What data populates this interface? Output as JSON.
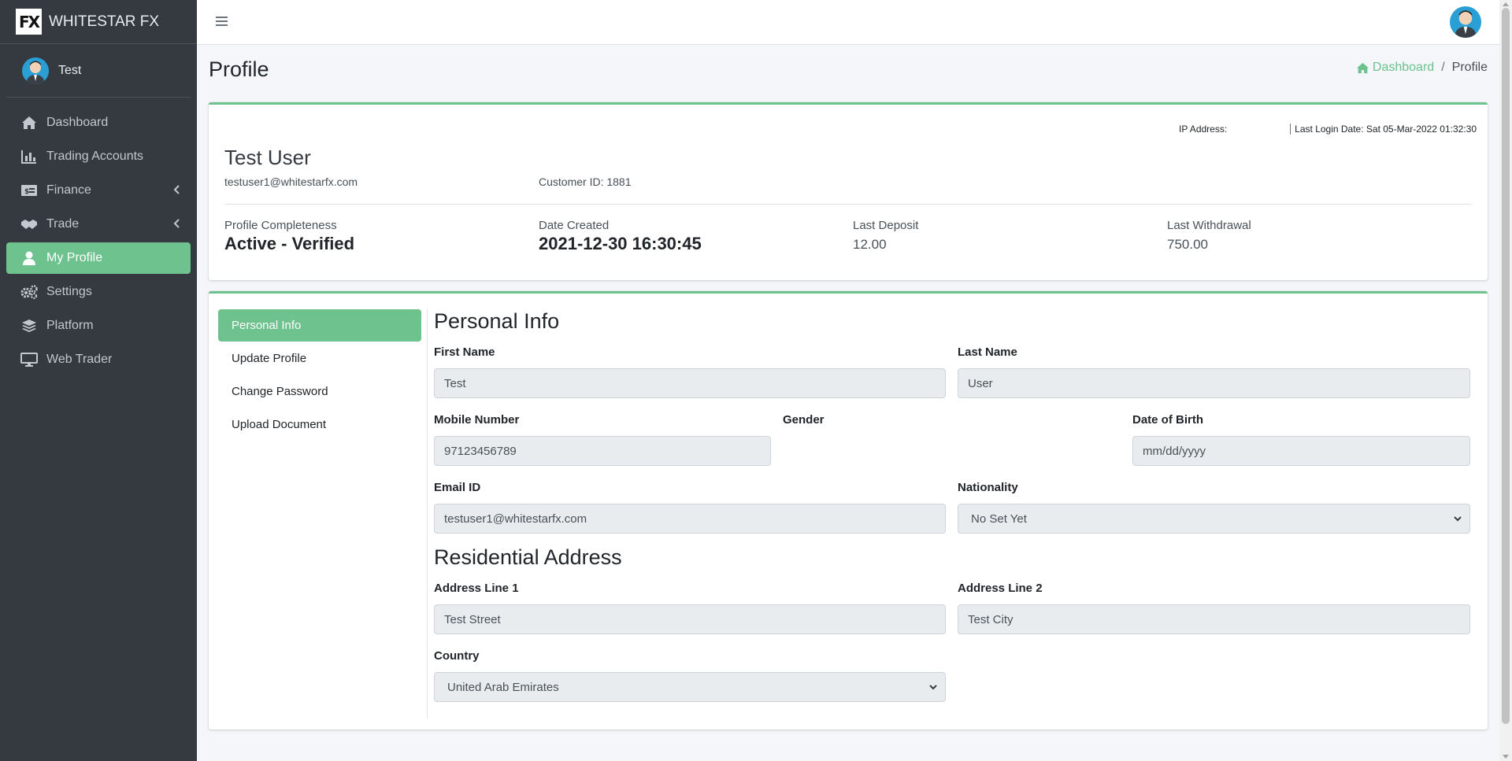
{
  "brand": {
    "logo": "FX",
    "name": "WHITESTAR FX"
  },
  "user": {
    "name": "Test"
  },
  "sidebar": {
    "items": [
      {
        "label": "Dashboard",
        "icon": "home-icon"
      },
      {
        "label": "Trading Accounts",
        "icon": "chart-bar-icon"
      },
      {
        "label": "Finance",
        "icon": "money-bill-icon",
        "has_submenu": true
      },
      {
        "label": "Trade",
        "icon": "handshake-icon",
        "has_submenu": true
      },
      {
        "label": "My Profile",
        "icon": "user-icon",
        "active": true
      },
      {
        "label": "Settings",
        "icon": "cogs-icon"
      },
      {
        "label": "Platform",
        "icon": "layers-icon"
      },
      {
        "label": "Web Trader",
        "icon": "desktop-icon"
      }
    ]
  },
  "header": {
    "title": "Profile",
    "breadcrumb": {
      "home": "Dashboard",
      "sep": "/",
      "current": "Profile"
    }
  },
  "profile": {
    "ip_label": "IP Address:",
    "last_login": "Last Login Date: Sat 05-Mar-2022 01:32:30",
    "name": "Test User",
    "email": "testuser1@whitestarfx.com",
    "customer_id": "Customer ID: 1881",
    "stats": {
      "completeness_label": "Profile Completeness",
      "completeness_value": "Active - Verified",
      "created_label": "Date Created",
      "created_value": "2021-12-30 16:30:45",
      "deposit_label": "Last Deposit",
      "deposit_value": "12.00",
      "withdrawal_label": "Last Withdrawal",
      "withdrawal_value": "750.00"
    }
  },
  "tabs": [
    "Personal Info",
    "Update Profile",
    "Change Password",
    "Upload Document"
  ],
  "personal": {
    "title": "Personal Info",
    "first_name_label": "First Name",
    "first_name": "Test",
    "last_name_label": "Last Name",
    "last_name": "User",
    "mobile_label": "Mobile Number",
    "mobile": "97123456789",
    "gender_label": "Gender",
    "dob_label": "Date of Birth",
    "dob_placeholder": "mm/dd/yyyy",
    "email_label": "Email ID",
    "email": "testuser1@whitestarfx.com",
    "nationality_label": "Nationality",
    "nationality": "No Set Yet"
  },
  "address": {
    "title": "Residential Address",
    "line1_label": "Address Line 1",
    "line1": "Test Street",
    "line2_label": "Address Line 2",
    "line2": "Test City",
    "country_label": "Country",
    "country": "United Arab Emirates"
  },
  "colors": {
    "accent": "#6dc28e",
    "sidebar": "#343a40",
    "avatar": "#2a9fd6"
  }
}
